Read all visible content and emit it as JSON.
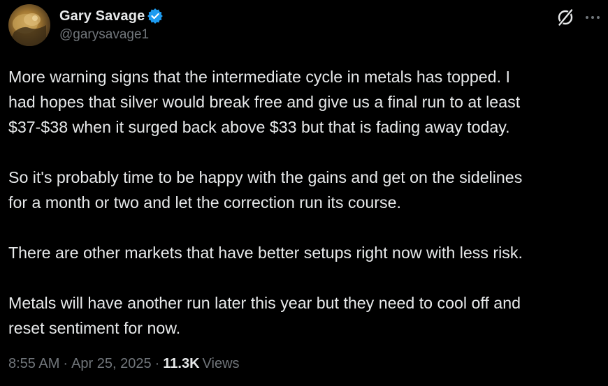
{
  "author": {
    "display_name": "Gary Savage",
    "handle": "@garysavage1",
    "verified": true,
    "avatar_icon": "profile-avatar",
    "verified_icon": "verified-badge-icon",
    "verified_color": "#1d9bf0"
  },
  "toolbar": {
    "grok_icon": "grok-icon",
    "more_icon": "more-options-icon"
  },
  "tweet": {
    "paragraphs": [
      "More warning signs that the intermediate cycle in metals has topped. I\nhad hopes that silver would break free and give us a final run to at least\n$37-$38 when it surged back above $33 but that is fading away today.",
      "So it's probably time to be happy with the gains and get on the sidelines\nfor a month or two and let the correction run its course.",
      "There are other markets that have better setups right now with less risk.",
      "Metals will have another run later this year but they need to cool off and\nreset sentiment for now."
    ]
  },
  "meta": {
    "time": "8:55 AM",
    "separator": "·",
    "date": "Apr 25, 2025",
    "views_count": "11.3K",
    "views_label": "Views"
  },
  "colors": {
    "background": "#000000",
    "primary_text": "#e7e9ea",
    "secondary_text": "#71767b"
  }
}
